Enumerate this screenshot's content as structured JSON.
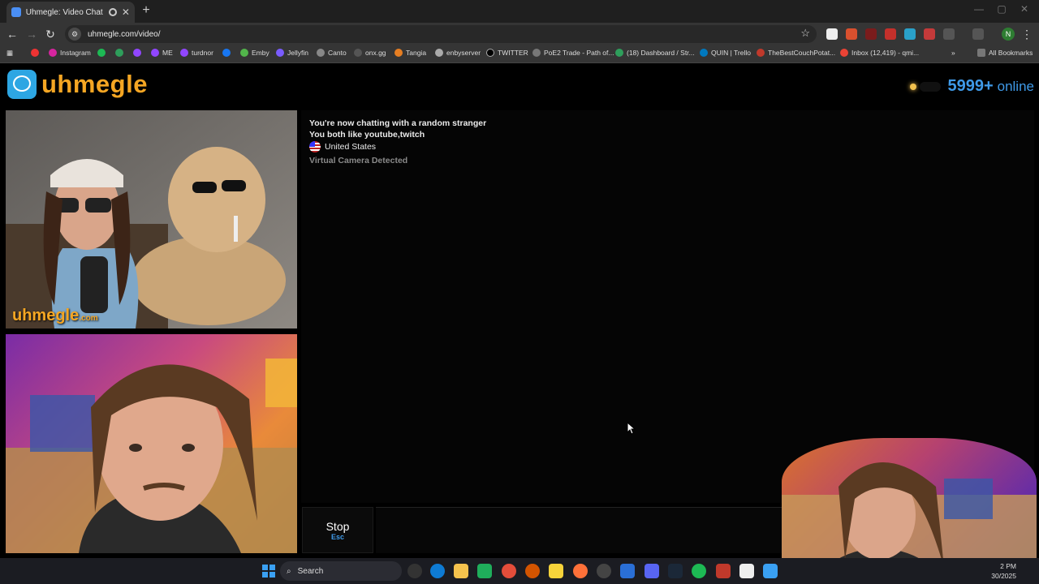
{
  "browser": {
    "tab_title": "Uhmegle: Video Chat | Ran...",
    "url": "uhmegle.com/video/",
    "bookmarks": [
      "Instagram",
      "turdnor",
      "ME",
      "turdnor",
      "Emby",
      "Jellyfin",
      "Canto",
      "onx.gg",
      "Tangia",
      "enbyserver",
      "TWITTER",
      "PoE2 Trade - Path of...",
      "(18) Dashboard / Str...",
      "QUIN | Trello",
      "TheBestCouchPotat...",
      "Inbox (12,419) - qmi..."
    ],
    "all_bookmarks": "All Bookmarks",
    "profile_initial": "N"
  },
  "site": {
    "logo": "uhmegle",
    "online_count": "5999+",
    "online_label": "online",
    "watermark": "uhmegle",
    "watermark_suffix": ".com"
  },
  "chat": {
    "line1": "You're now chatting with a random stranger",
    "line2": "You both like youtube,twitch",
    "country": "United States",
    "notice": "Virtual Camera Detected"
  },
  "controls": {
    "stop_label": "Stop",
    "stop_key": "Esc"
  },
  "taskbar": {
    "search_label": "Search",
    "time": "2 PM",
    "date": "30/2025"
  },
  "colors": {
    "accent_orange": "#f5a623",
    "accent_blue": "#3f9ae8"
  }
}
